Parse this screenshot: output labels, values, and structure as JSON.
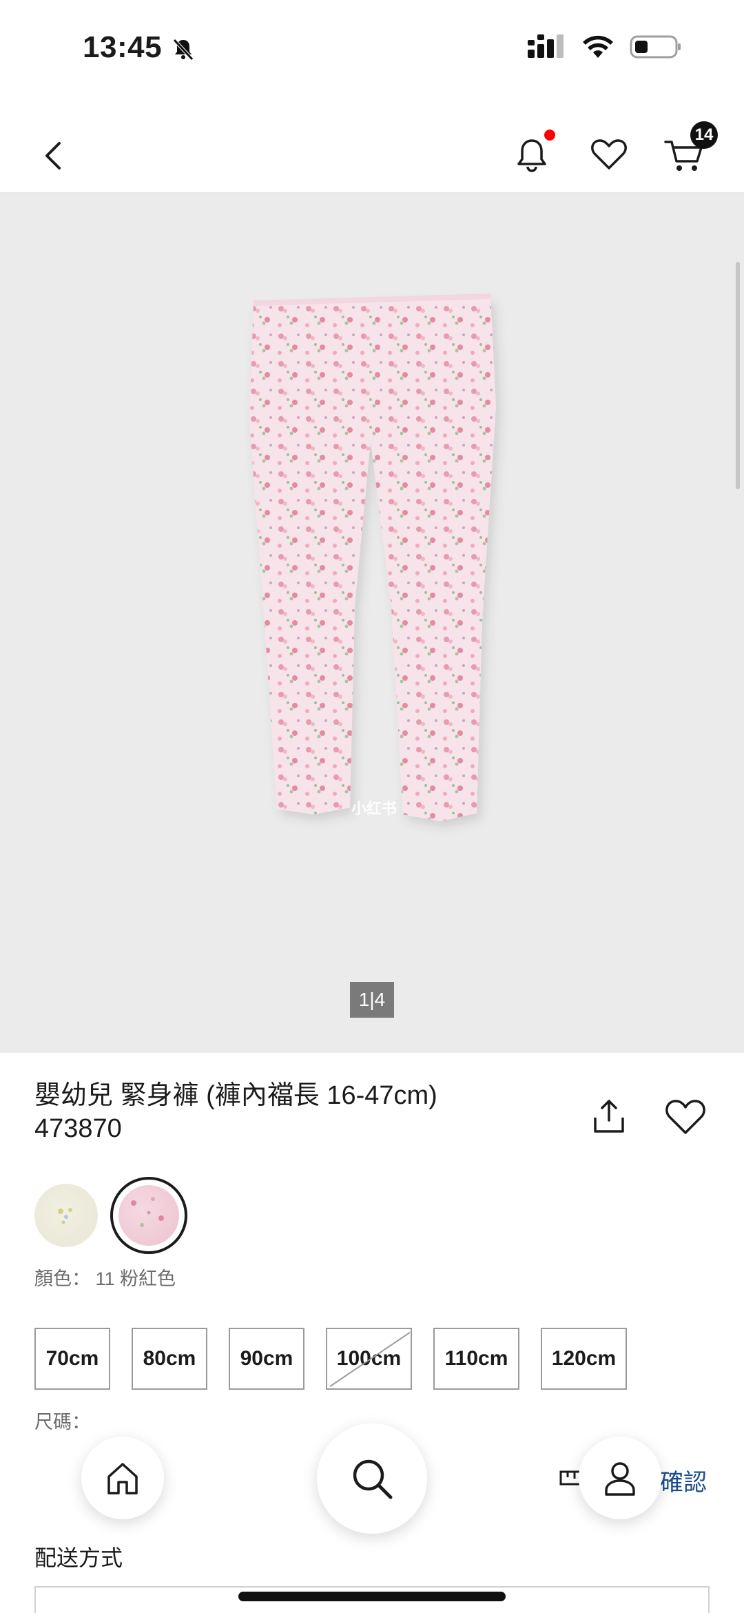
{
  "status_bar": {
    "time": "13:45"
  },
  "nav": {
    "cart_count": "14"
  },
  "gallery": {
    "pager": "1|4",
    "watermark": "小红书"
  },
  "product": {
    "title": "嬰幼兒 緊身褲 (褲內襠長 16-47cm)",
    "code": "473870",
    "color_label": "顏色：  11 粉紅色",
    "colors": [
      {
        "name": "light-yellow",
        "hex": "#eeecdc"
      },
      {
        "name": "pink",
        "hex": "#f1cfd9",
        "selected": true
      }
    ],
    "sizes": [
      {
        "label": "70cm",
        "available": true
      },
      {
        "label": "80cm",
        "available": true
      },
      {
        "label": "90cm",
        "available": true
      },
      {
        "label": "100cm",
        "available": false
      },
      {
        "label": "110cm",
        "available": true
      },
      {
        "label": "120cm",
        "available": true
      }
    ],
    "size_label": "尺碼：",
    "size_confirm_ghost": "尺碼",
    "size_confirm": "確認"
  },
  "delivery": {
    "title": "配送方式"
  },
  "theme": {
    "accent": "#1a4b8c",
    "badge": "#111111",
    "notification": "#ff0000",
    "hero_bg": "#ebebeb"
  }
}
